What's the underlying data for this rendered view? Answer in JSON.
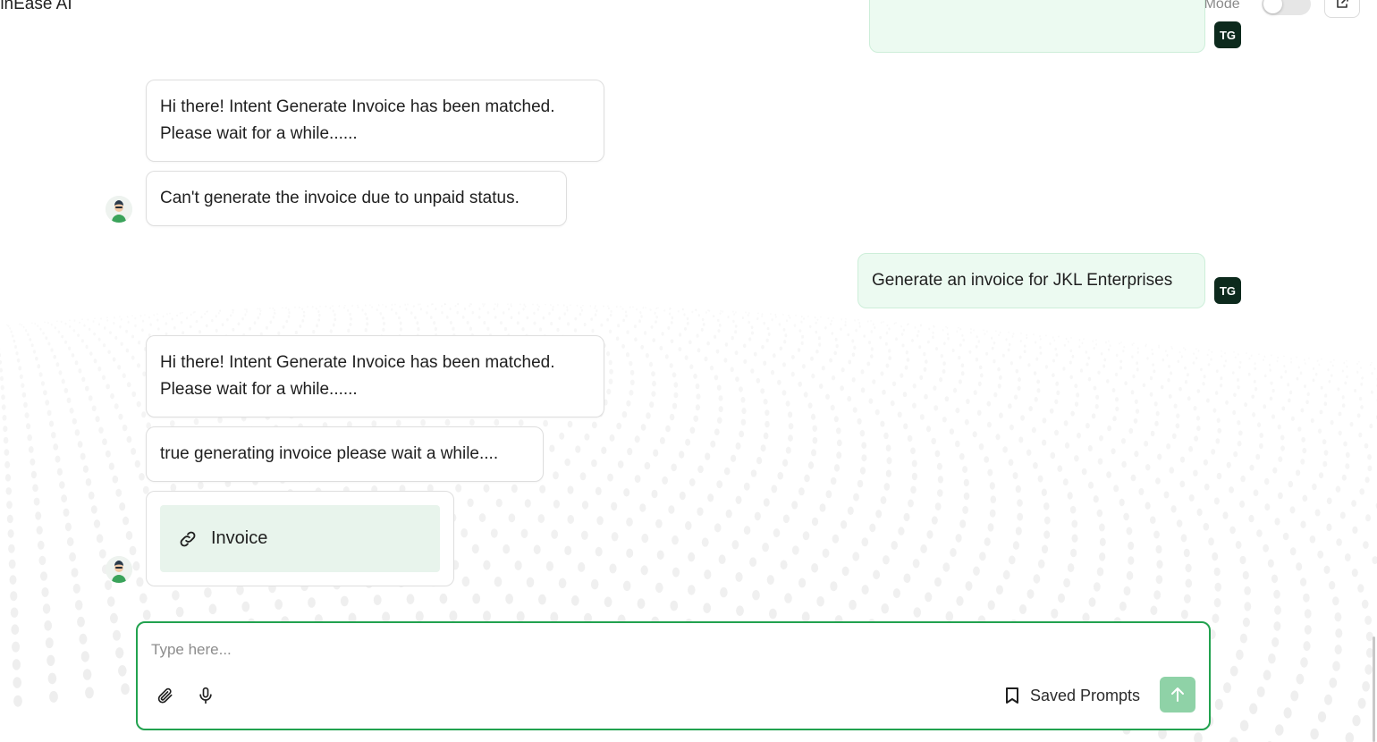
{
  "header": {
    "app_title": "rinEase AI",
    "debug_label": "Debug Mode",
    "debug_enabled": false
  },
  "messages": {
    "user_1_initials": "TG",
    "bot_1_text": "Hi there! Intent Generate Invoice has been matched.\nPlease wait for a while......",
    "bot_2_text": "Can't generate the invoice due to unpaid status.",
    "user_2_text": "Generate an invoice for JKL Enterprises",
    "user_2_initials": "TG",
    "bot_3_text": "Hi there! Intent Generate Invoice has been matched.\nPlease wait for a while......",
    "bot_4_text": "true generating invoice please wait a while....",
    "invoice_link_label": "Invoice"
  },
  "composer": {
    "placeholder": "Type here...",
    "value": "",
    "saved_prompts_label": "Saved Prompts"
  },
  "colors": {
    "accent": "#22a24f",
    "user_bubble": "#ecfaf1",
    "avatar_bg": "#0d2a1d",
    "send_button": "#8fd2a7",
    "link_card": "#e8f4ec"
  },
  "icons": {
    "attach": "paperclip-icon",
    "mic": "microphone-icon",
    "saved": "bookmark-icon",
    "send": "arrow-up-icon",
    "link": "link-icon",
    "export": "export-icon"
  }
}
